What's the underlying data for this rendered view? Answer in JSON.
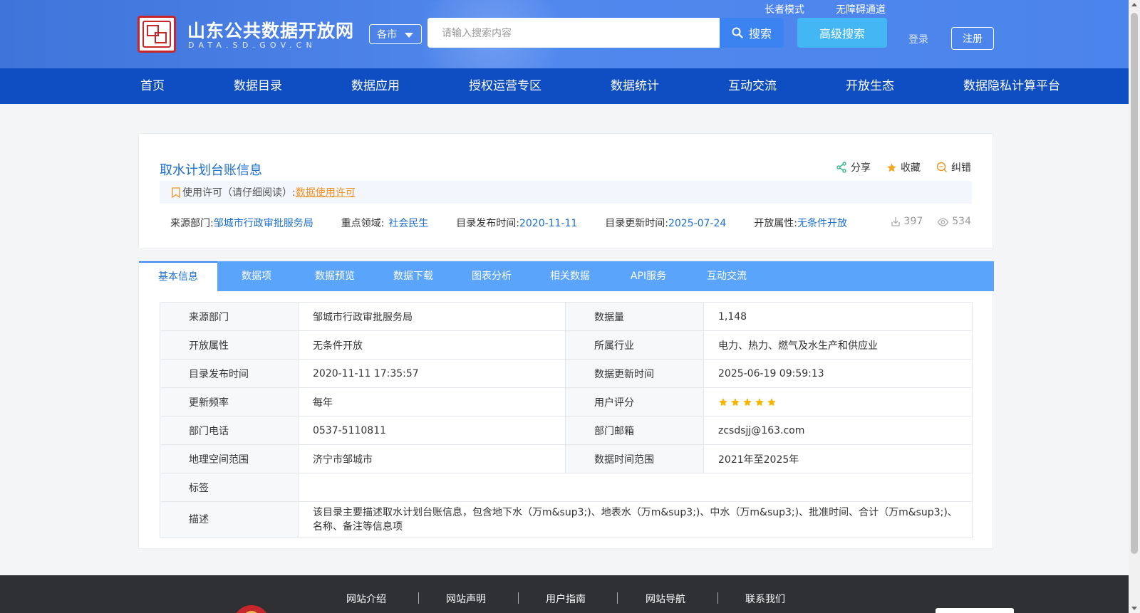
{
  "header": {
    "site_title": "山东公共数据开放网",
    "site_domain": "DATA.SD.GOV.CN",
    "city_select": "各市",
    "search_placeholder": "请输入搜索内容",
    "search_button": "搜索",
    "advanced_search": "高级搜索",
    "elder_mode": "长者模式",
    "barrier_free": "无障碍通道",
    "login": "登录",
    "register": "注册"
  },
  "nav": {
    "items": [
      "首页",
      "数据目录",
      "数据应用",
      "授权运营专区",
      "数据统计",
      "互动交流",
      "开放生态",
      "数据隐私计算平台"
    ]
  },
  "dataset": {
    "title": "取水计划台账信息",
    "actions": {
      "share": "分享",
      "favorite": "收藏",
      "report_error": "纠错"
    },
    "license_prefix": "使用许可（请仔细阅读）:",
    "license_link": "数据使用许可",
    "meta": {
      "source_label": "来源部门:",
      "source_value": "邹城市行政审批服务局",
      "domain_label": "重点领域:",
      "domain_value": "社会民生",
      "publish_label": "目录发布时间:",
      "publish_value": "2020-11-11",
      "update_label": "目录更新时间:",
      "update_value": "2025-07-24",
      "open_label": "开放属性:",
      "open_value": "无条件开放"
    },
    "downloads": "397",
    "views": "534"
  },
  "tabs": [
    "基本信息",
    "数据项",
    "数据预览",
    "数据下载",
    "图表分析",
    "相关数据",
    "API服务",
    "互动交流"
  ],
  "info_table": {
    "rows": [
      {
        "k1": "来源部门",
        "v1": "邹城市行政审批服务局",
        "k2": "数据量",
        "v2": "1,148"
      },
      {
        "k1": "开放属性",
        "v1": "无条件开放",
        "k2": "所属行业",
        "v2": "电力、热力、燃气及水生产和供应业"
      },
      {
        "k1": "目录发布时间",
        "v1": "2020-11-11 17:35:57",
        "k2": "数据更新时间",
        "v2": "2025-06-19 09:59:13"
      },
      {
        "k1": "更新频率",
        "v1": "每年",
        "k2": "用户评分",
        "v2": ""
      },
      {
        "k1": "部门电话",
        "v1": "0537-5110811",
        "k2": "部门邮箱",
        "v2": "zcsdsjj@163.com"
      },
      {
        "k1": "地理空间范围",
        "v1": "济宁市邹城市",
        "k2": "数据时间范围",
        "v2": "2021年至2025年"
      }
    ],
    "tags_label": "标签",
    "tags_value": "",
    "desc_label": "描述",
    "desc_value": "该目录主要描述取水计划台账信息，包含地下水（万m&sup3;)、地表水（万m&sup3;)、中水（万m&sup3;)、批准时间、合计（万m&sup3;)、名称、备注等信息项",
    "rating_stars": 5
  },
  "footer": {
    "links": [
      "网站介绍",
      "网站声明",
      "用户指南",
      "网站导航",
      "联系我们"
    ]
  },
  "colors": {
    "header_blue": "#4b84ec",
    "nav_blue": "#0f4dc2",
    "link_blue": "#1c6fd1",
    "tab_blue": "#5ba4fb",
    "license_orange": "#f0921f",
    "star_gold": "#f7b500"
  },
  "icons": {
    "search": "search-icon",
    "share": "share-icon",
    "favorite": "star-icon",
    "report": "error-report-icon",
    "license": "bookmark-icon",
    "downloads": "download-icon",
    "views": "eye-icon"
  }
}
